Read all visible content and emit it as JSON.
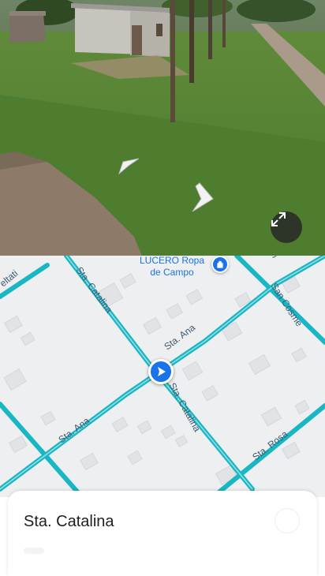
{
  "street_view": {
    "scene": "rural-dirt-road-street-view",
    "nav_arrows": [
      "arrow-left-icon",
      "arrow-right-icon"
    ],
    "expand_icon": "expand-icon"
  },
  "map": {
    "road_color": "#19b6c4",
    "background": "#eeeff1",
    "streets": {
      "catalina_north": "Sta. Catalina",
      "catalina_south": "Sta. Catalina",
      "ana_east": "Sta. Ana",
      "ana_west": "Sta. Ana",
      "rosa": "Sta. Rosa",
      "cosme": "San Cosme",
      "left_edge": "eltati",
      "top_edge": "S"
    },
    "poi": {
      "line1": "LUCERO Ropa",
      "line2": "de Campo",
      "icon": "shopping-bag-icon"
    },
    "user_marker_icon": "navigation-arrow-icon"
  },
  "sheet": {
    "title": "Sta. Catalina"
  }
}
